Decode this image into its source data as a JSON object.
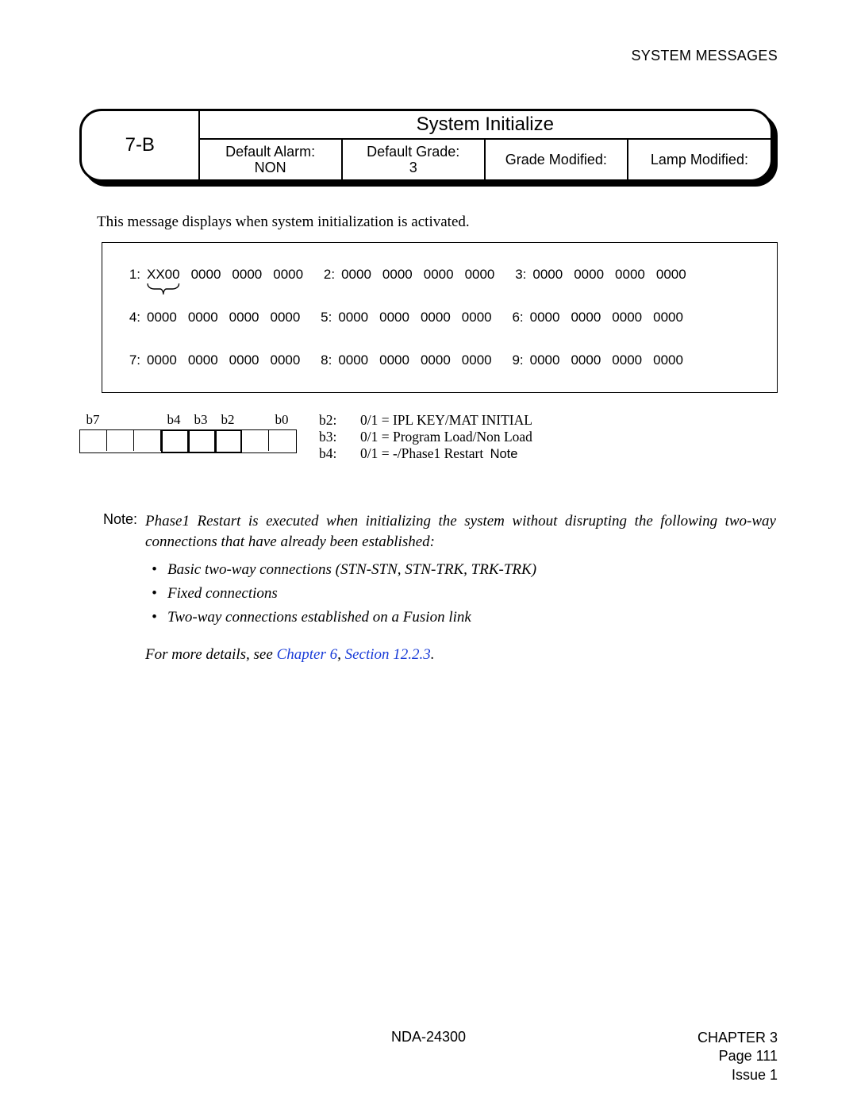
{
  "running_head": "SYSTEM MESSAGES",
  "card": {
    "code": "7-B",
    "title": "System Initialize",
    "cells": [
      {
        "label": "Default Alarm:",
        "value": "NON"
      },
      {
        "label": "Default Grade:",
        "value": "3"
      },
      {
        "label": "Grade Modified:",
        "value": ""
      },
      {
        "label": "Lamp Modified:",
        "value": ""
      }
    ]
  },
  "intro": "This message displays when system initialization is activated.",
  "dump": {
    "emphasis_word": "XX00",
    "rows": [
      [
        {
          "idx": "1:",
          "words": [
            "XX00",
            "0000",
            "0000",
            "0000"
          ]
        },
        {
          "idx": "2:",
          "words": [
            "0000",
            "0000",
            "0000",
            "0000"
          ]
        },
        {
          "idx": "3:",
          "words": [
            "0000",
            "0000",
            "0000",
            "0000"
          ]
        }
      ],
      [
        {
          "idx": "4:",
          "words": [
            "0000",
            "0000",
            "0000",
            "0000"
          ]
        },
        {
          "idx": "5:",
          "words": [
            "0000",
            "0000",
            "0000",
            "0000"
          ]
        },
        {
          "idx": "6:",
          "words": [
            "0000",
            "0000",
            "0000",
            "0000"
          ]
        }
      ],
      [
        {
          "idx": "7:",
          "words": [
            "0000",
            "0000",
            "0000",
            "0000"
          ]
        },
        {
          "idx": "8:",
          "words": [
            "0000",
            "0000",
            "0000",
            "0000"
          ]
        },
        {
          "idx": "9:",
          "words": [
            "0000",
            "0000",
            "0000",
            "0000"
          ]
        }
      ]
    ]
  },
  "bits": {
    "labels": [
      "b7",
      "",
      "",
      "b4",
      "b3",
      "b2",
      "",
      "b0"
    ],
    "desc": [
      {
        "k": "b2:",
        "v": "0/1 = IPL KEY/MAT INITIAL"
      },
      {
        "k": "b3:",
        "v": "0/1 = Program Load/Non Load"
      },
      {
        "k": "b4:",
        "v": "0/1 = -/Phase1 Restart",
        "note": "Note"
      }
    ]
  },
  "note": {
    "tag": "Note:",
    "text": "Phase1 Restart is executed when initializing the system without disrupting the following two-way connections that have already been established:",
    "bullets": [
      "Basic two-way connections (STN-STN, STN-TRK, TRK-TRK)",
      "Fixed connections",
      "Two-way connections established on a Fusion link"
    ],
    "seealso_pre": "For more details, see ",
    "seealso_link1": "Chapter 6",
    "seealso_sep": ", ",
    "seealso_link2": "Section 12.2.3",
    "seealso_post": "."
  },
  "footer": {
    "doc": "NDA-24300",
    "chapter": "CHAPTER 3",
    "page": "Page 111",
    "issue": "Issue 1"
  }
}
